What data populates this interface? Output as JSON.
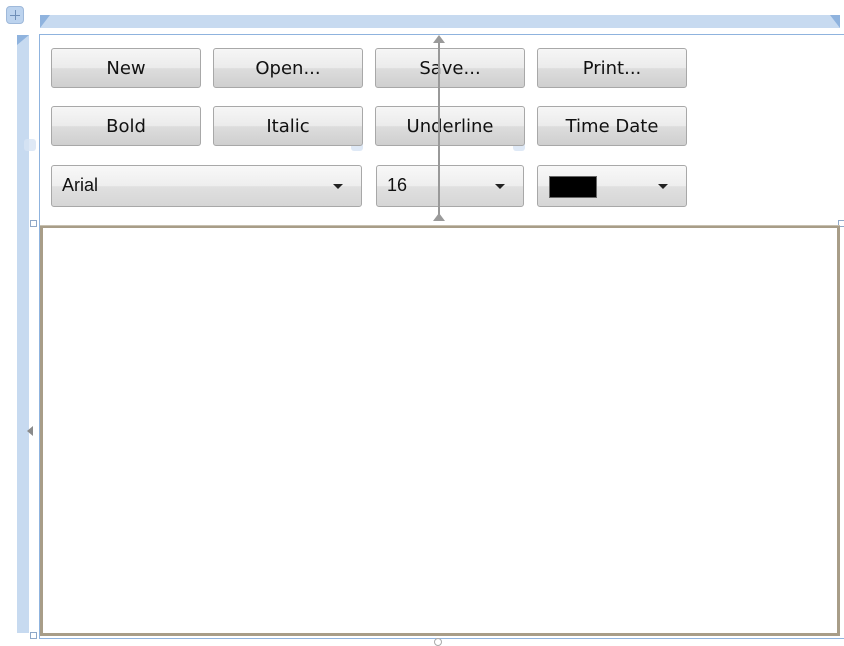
{
  "toolbar": {
    "row1": {
      "new_label": "New",
      "open_label": "Open...",
      "save_label": "Save...",
      "print_label": "Print..."
    },
    "row2": {
      "bold_label": "Bold",
      "italic_label": "Italic",
      "underline_label": "Underline",
      "timedate_label": "Time Date"
    },
    "row3": {
      "font_family": "Arial",
      "font_size": "16",
      "font_color": "#000000"
    }
  },
  "editor": {
    "content": ""
  },
  "colors": {
    "designer_rail": "#c7daf0",
    "editor_border": "#a89d88",
    "button_border": "#a8a8a8"
  },
  "icons": [
    "move-adorner-icon",
    "dropdown-arrow-icon",
    "splitter-arrow-icon",
    "collapse-left-arrow-icon"
  ]
}
